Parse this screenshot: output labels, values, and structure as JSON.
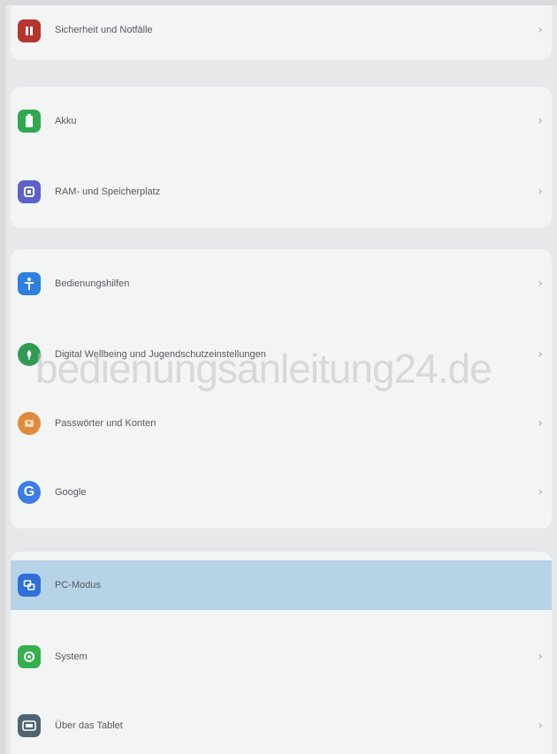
{
  "settings": {
    "items": [
      {
        "label": "Sicherheit und Notfälle",
        "icon": "emergency-icon",
        "color": "#b5362f"
      },
      {
        "label": "Akku",
        "icon": "battery-icon",
        "color": "#2fa84f"
      },
      {
        "label": "RAM- und Speicherplatz",
        "icon": "storage-icon",
        "color": "#5b63c9"
      },
      {
        "label": "Bedienungshilfen",
        "icon": "accessibility-icon",
        "color": "#2f7fe0"
      },
      {
        "label": "Digital Wellbeing und Jugendschutzeinstellungen",
        "icon": "wellbeing-icon",
        "color": "#2f9a52"
      },
      {
        "label": "Passwörter und Konten",
        "icon": "accounts-icon",
        "color": "#e08a3b"
      },
      {
        "label": "Google",
        "icon": "google-icon",
        "color": "#3c7be8"
      },
      {
        "label": "PC-Modus",
        "icon": "pc-mode-icon",
        "color": "#2f6fd8"
      },
      {
        "label": "System",
        "icon": "system-icon",
        "color": "#35b04d"
      },
      {
        "label": "Über das Tablet",
        "icon": "tablet-info-icon",
        "color": "#4f6470"
      }
    ]
  },
  "watermark": "bedienungsanleitung24.de",
  "chevron": "›"
}
